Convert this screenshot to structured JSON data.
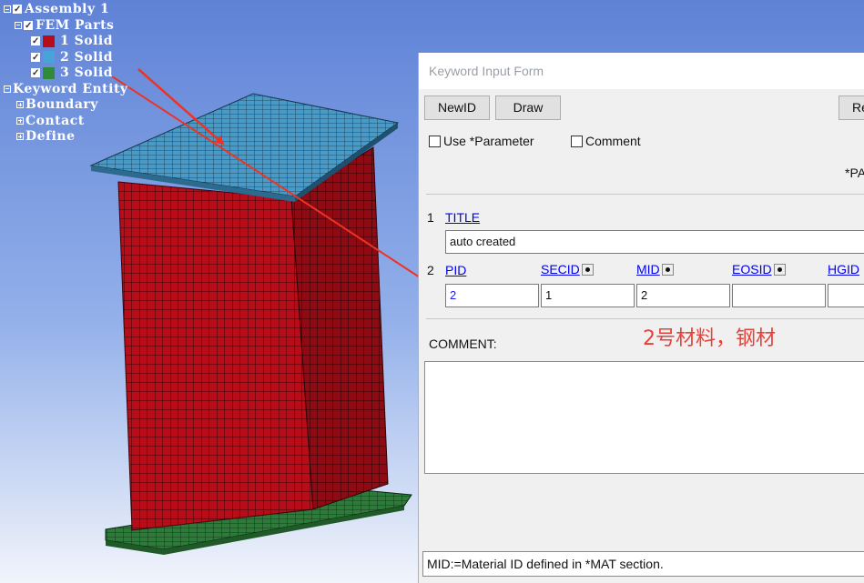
{
  "tree": {
    "assembly": "Assembly 1",
    "fem_parts": "FEM Parts",
    "parts": [
      {
        "label": "1 Solid",
        "color": "#b80d19"
      },
      {
        "label": "2 Solid",
        "color": "#4aa3d8"
      },
      {
        "label": "3 Solid",
        "color": "#2f8a3a"
      }
    ],
    "keyword_entity": "Keyword Entity",
    "children": [
      "Boundary",
      "Contact",
      "Define"
    ]
  },
  "form": {
    "window_title": "Keyword Input Form",
    "buttons": {
      "newid": "NewID",
      "draw": "Draw",
      "right_cut": "Re"
    },
    "use_parameter": "Use *Parameter",
    "comment_checkbox": "Comment",
    "pa_cut": "*PA",
    "row1": {
      "num": "1",
      "title_link": "TITLE",
      "title_value": "auto created"
    },
    "row2": {
      "num": "2",
      "pid_label": "PID",
      "secid_label": "SECID",
      "mid_label": "MID",
      "eosid_label": "EOSID",
      "hgid_label": "HGID",
      "pid_value": "2",
      "secid_value": "1",
      "mid_value": "2"
    },
    "annotation": "2号材料，钢材",
    "comment_label": "COMMENT:",
    "status": "MID:=Material ID defined in *MAT section."
  },
  "colors": {
    "solid_red": "#b80d19",
    "plate_blue": "#4a9ac8",
    "plate_green": "#2e7a3a",
    "arrow": "#ee3324"
  }
}
